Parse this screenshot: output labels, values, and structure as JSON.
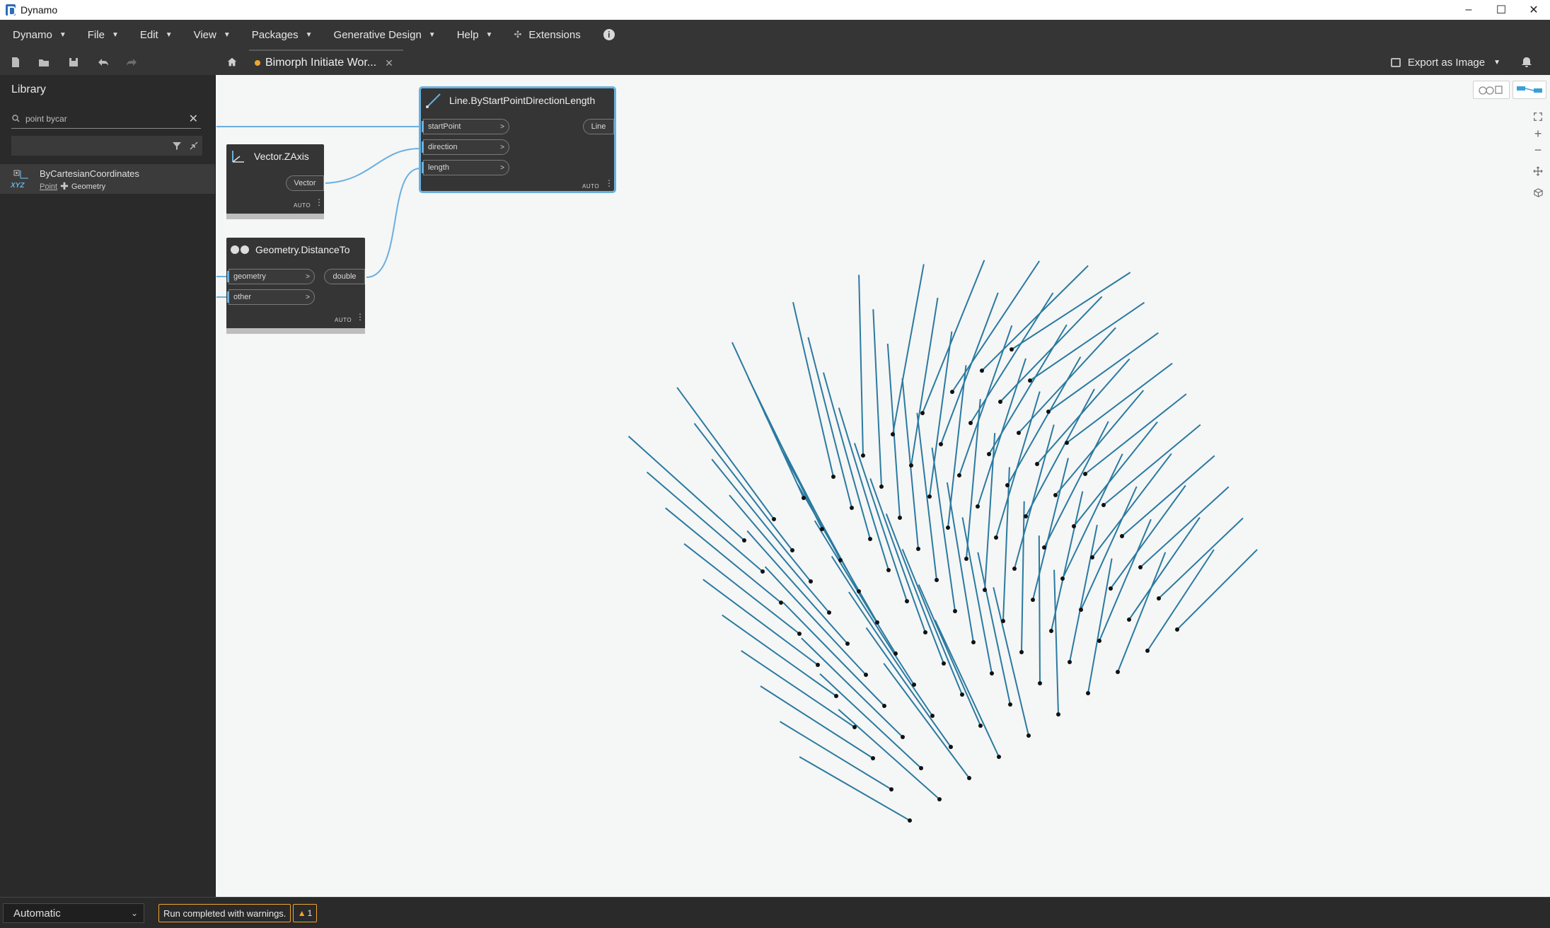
{
  "window": {
    "title": "Dynamo",
    "minimize": "–",
    "maximize": "☐",
    "close": "✕"
  },
  "menu": {
    "items": [
      {
        "label": "Dynamo"
      },
      {
        "label": "File"
      },
      {
        "label": "Edit"
      },
      {
        "label": "View"
      },
      {
        "label": "Packages"
      },
      {
        "label": "Generative Design"
      },
      {
        "label": "Help"
      }
    ],
    "extensions_label": "Extensions",
    "info_glyph": "i"
  },
  "toolbar": {
    "tab_title": "Bimorph Initiate Wor...",
    "tab_close": "✕",
    "export_label": "Export as Image"
  },
  "library": {
    "title": "Library",
    "search_value": "point bycar",
    "search_clear": "✕",
    "result": {
      "name": "ByCartesianCoordinates",
      "category": "Point",
      "subcategory": "Geometry",
      "icon_glyph": "XYZ"
    }
  },
  "nodes": {
    "line": {
      "title": "Line.ByStartPointDirectionLength",
      "inputs": [
        "startPoint",
        "direction",
        "length"
      ],
      "output": "Line",
      "run_label": "AUTO"
    },
    "zaxis": {
      "title": "Vector.ZAxis",
      "output": "Vector",
      "run_label": "AUTO"
    },
    "distance": {
      "title": "Geometry.DistanceTo",
      "inputs": [
        "geometry",
        "other"
      ],
      "output": "double",
      "run_label": "AUTO"
    }
  },
  "status": {
    "run_mode": "Automatic",
    "message": "Run completed with warnings.",
    "warning_count": "1"
  },
  "colors": {
    "line_stroke": "#2a7aa0",
    "accent_blue": "#6ab0de",
    "warning_orange": "#f0a52e",
    "dark_panel": "#353535"
  },
  "icons": [
    "file-new-icon",
    "folder-open-icon",
    "save-icon",
    "undo-icon",
    "redo-icon",
    "home-icon",
    "image-icon",
    "bell-icon",
    "search-icon",
    "filter-icon",
    "collapse-icon",
    "zoom-fit-icon",
    "zoom-in-icon",
    "zoom-out-icon",
    "pan-icon",
    "orbit-icon"
  ]
}
